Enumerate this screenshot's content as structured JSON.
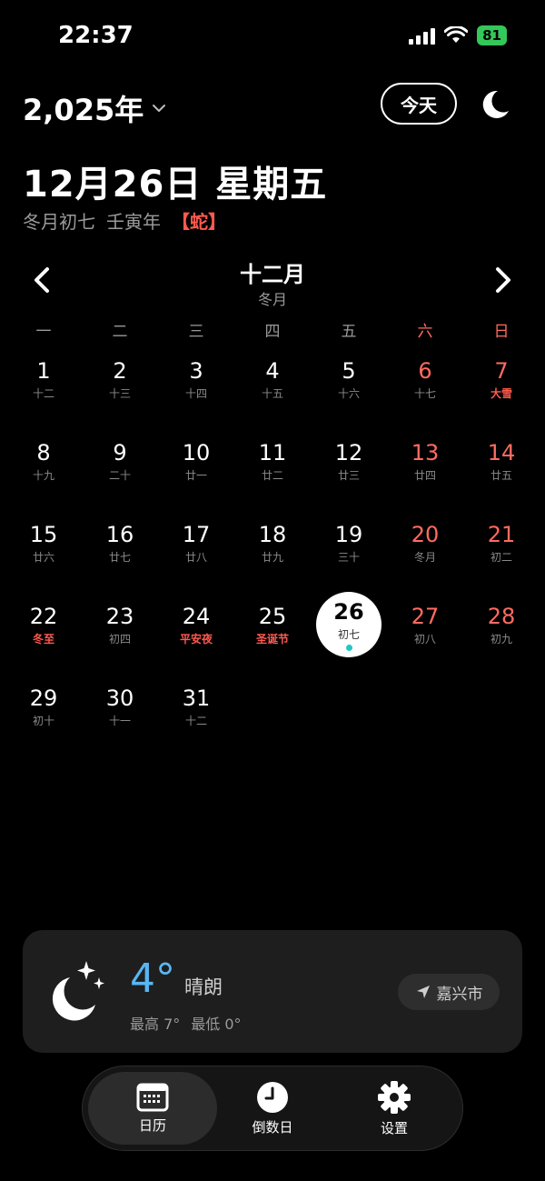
{
  "status": {
    "time": "22:37",
    "battery": "81"
  },
  "header": {
    "year": "2,025年",
    "today_label": "今天"
  },
  "date": {
    "title": "12月26日 星期五",
    "lunar_month_day": "冬月初七",
    "ganzhi_year": "壬寅年",
    "zodiac": "【蛇】"
  },
  "month": {
    "title": "十二月",
    "lunar": "冬月"
  },
  "weekdays": [
    "一",
    "二",
    "三",
    "四",
    "五",
    "六",
    "日"
  ],
  "days": [
    {
      "num": "1",
      "lunar": "十二"
    },
    {
      "num": "2",
      "lunar": "十三"
    },
    {
      "num": "3",
      "lunar": "十四"
    },
    {
      "num": "4",
      "lunar": "十五"
    },
    {
      "num": "5",
      "lunar": "十六"
    },
    {
      "num": "6",
      "lunar": "十七"
    },
    {
      "num": "7",
      "lunar": "大雪",
      "festival": true
    },
    {
      "num": "8",
      "lunar": "十九"
    },
    {
      "num": "9",
      "lunar": "二十"
    },
    {
      "num": "10",
      "lunar": "廿一"
    },
    {
      "num": "11",
      "lunar": "廿二"
    },
    {
      "num": "12",
      "lunar": "廿三"
    },
    {
      "num": "13",
      "lunar": "廿四"
    },
    {
      "num": "14",
      "lunar": "廿五"
    },
    {
      "num": "15",
      "lunar": "廿六"
    },
    {
      "num": "16",
      "lunar": "廿七"
    },
    {
      "num": "17",
      "lunar": "廿八"
    },
    {
      "num": "18",
      "lunar": "廿九"
    },
    {
      "num": "19",
      "lunar": "三十"
    },
    {
      "num": "20",
      "lunar": "冬月"
    },
    {
      "num": "21",
      "lunar": "初二"
    },
    {
      "num": "22",
      "lunar": "冬至",
      "festival": true
    },
    {
      "num": "23",
      "lunar": "初四"
    },
    {
      "num": "24",
      "lunar": "平安夜",
      "festival": true
    },
    {
      "num": "25",
      "lunar": "圣诞节",
      "festival": true
    },
    {
      "num": "26",
      "lunar": "初七",
      "selected": true
    },
    {
      "num": "27",
      "lunar": "初八"
    },
    {
      "num": "28",
      "lunar": "初九"
    },
    {
      "num": "29",
      "lunar": "初十"
    },
    {
      "num": "30",
      "lunar": "十一"
    },
    {
      "num": "31",
      "lunar": "十二"
    }
  ],
  "weather": {
    "temp": "4°",
    "condition": "晴朗",
    "high": "最高 7°",
    "low": "最低 0°",
    "location": "嘉兴市"
  },
  "tabs": [
    {
      "label": "日历",
      "icon": "calendar-icon",
      "active": true
    },
    {
      "label": "倒数日",
      "icon": "clock-icon"
    },
    {
      "label": "设置",
      "icon": "gear-icon"
    }
  ],
  "colors": {
    "weekend": "#ff6b61",
    "festival": "#ff5a4f",
    "temp": "#58b6f3",
    "battery": "#34c759",
    "today_dot": "#1fc7c9"
  }
}
